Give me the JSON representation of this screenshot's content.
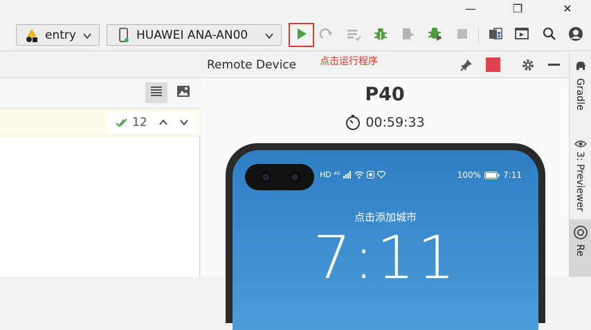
{
  "window_controls": {
    "minimize": "—",
    "restore": "❐",
    "close": "✕"
  },
  "toolbar": {
    "module_select": {
      "value": "entry"
    },
    "device_select": {
      "value": "HUAWEI ANA-AN00"
    },
    "run_label": "Run",
    "icons": [
      "run-icon",
      "rerun-icon",
      "apply-changes-icon",
      "debug-icon",
      "attach-debugger-icon",
      "profile-icon",
      "stop-icon",
      "project-structure-icon",
      "preview-icon",
      "search-icon",
      "account-icon"
    ]
  },
  "editor": {
    "inspections_count": "12"
  },
  "remote_device": {
    "title": "Remote Device",
    "annotation": "点击运行程序",
    "device_name": "P40",
    "timer": "00:59:33",
    "phone": {
      "status_left": "HD ⁴ᴳ",
      "status_battery": "100%",
      "status_time": "7:11",
      "city_prompt": "点击添加城市",
      "clock": "7:11"
    }
  },
  "side_tabs": {
    "gradle": "Gradle",
    "previewer": "3: Previewer",
    "remote": "Re"
  },
  "colors": {
    "run_green": "#4aa14a",
    "stop_red": "#e0434f",
    "annotation_red": "#e8301e",
    "highlight_box": "#e33a2e",
    "screen_blue": "#3a8acb"
  }
}
